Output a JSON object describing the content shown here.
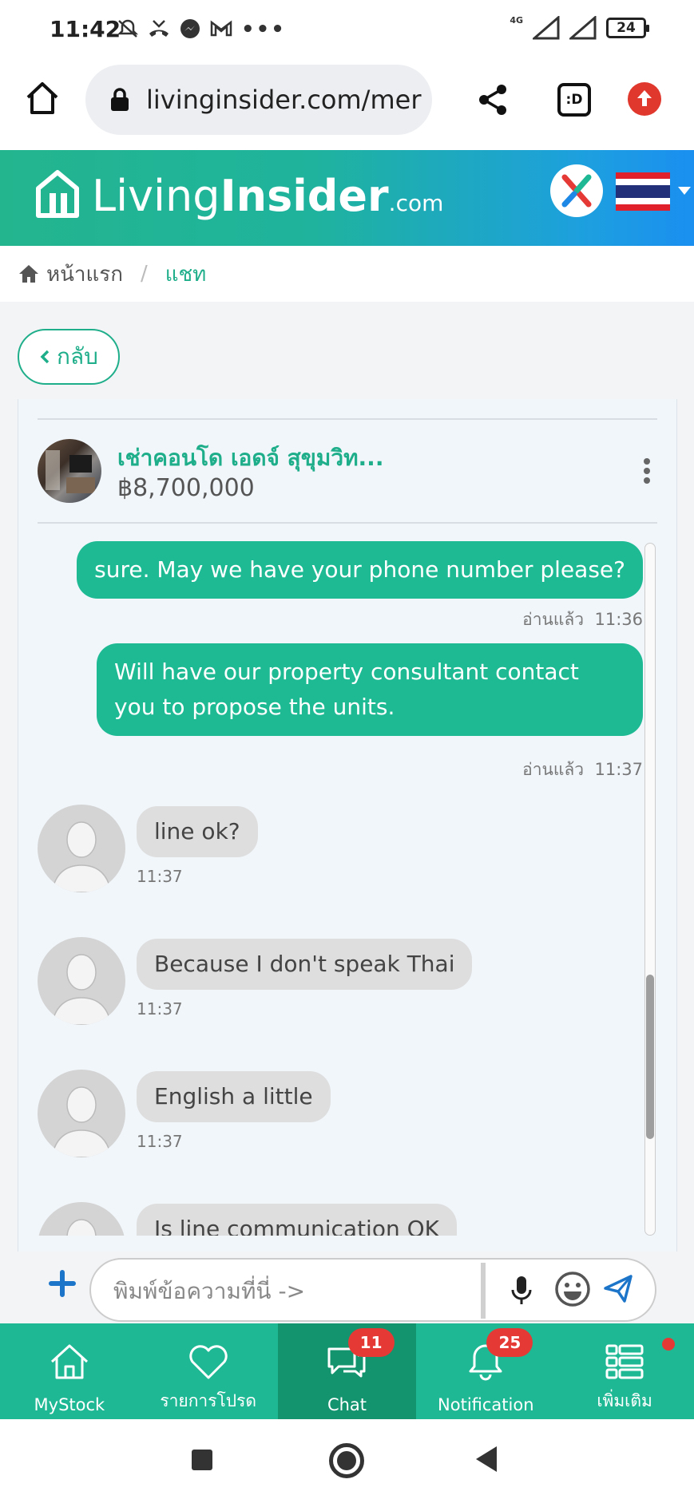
{
  "status_bar": {
    "time": "11:42",
    "network": "4G",
    "battery": "24",
    "more_label": "•••"
  },
  "browser": {
    "url": "livinginsider.com/mer",
    "tab_switcher_label": ":D"
  },
  "site": {
    "logo_part1": "Living",
    "logo_part2": "Insider",
    "logo_part3": ".com"
  },
  "breadcrumb": {
    "home": "หน้าแรก",
    "separator": "/",
    "current": "แชท"
  },
  "back_button": "กลับ",
  "listing": {
    "title": "เช่าคอนโด เอดจ์ สุขุมวิท...",
    "price": "฿8,700,000"
  },
  "messages": [
    {
      "direction": "out",
      "text": "sure. May we have your phone number please?",
      "status": "อ่านแล้ว",
      "time": "11:36"
    },
    {
      "direction": "out",
      "text": "Will have our property consultant contact you to propose the units.",
      "status": "อ่านแล้ว",
      "time": "11:37"
    },
    {
      "direction": "in",
      "text": "line ok?",
      "time": "11:37"
    },
    {
      "direction": "in",
      "text": "Because I don't speak Thai",
      "time": "11:37"
    },
    {
      "direction": "in",
      "text": "English a little",
      "time": "11:37"
    },
    {
      "direction": "in",
      "text": "Is line communication OK",
      "time": ""
    }
  ],
  "composer": {
    "placeholder": "พิมพ์ข้อความที่นี่ ->"
  },
  "bottom_nav": [
    {
      "label": "MyStock",
      "icon": "home-icon",
      "badge": ""
    },
    {
      "label": "รายการโปรด",
      "icon": "heart-icon",
      "badge": ""
    },
    {
      "label": "Chat",
      "icon": "chat-icon",
      "badge": "11"
    },
    {
      "label": "Notification",
      "icon": "bell-icon",
      "badge": "25"
    },
    {
      "label": "เพิ่มเติม",
      "icon": "menu-list-icon",
      "badge": ""
    }
  ],
  "colors": {
    "brand_green": "#1fb895",
    "outgoing_bubble": "#1dba94",
    "incoming_bubble": "#dedede",
    "badge_red": "#e53935"
  }
}
